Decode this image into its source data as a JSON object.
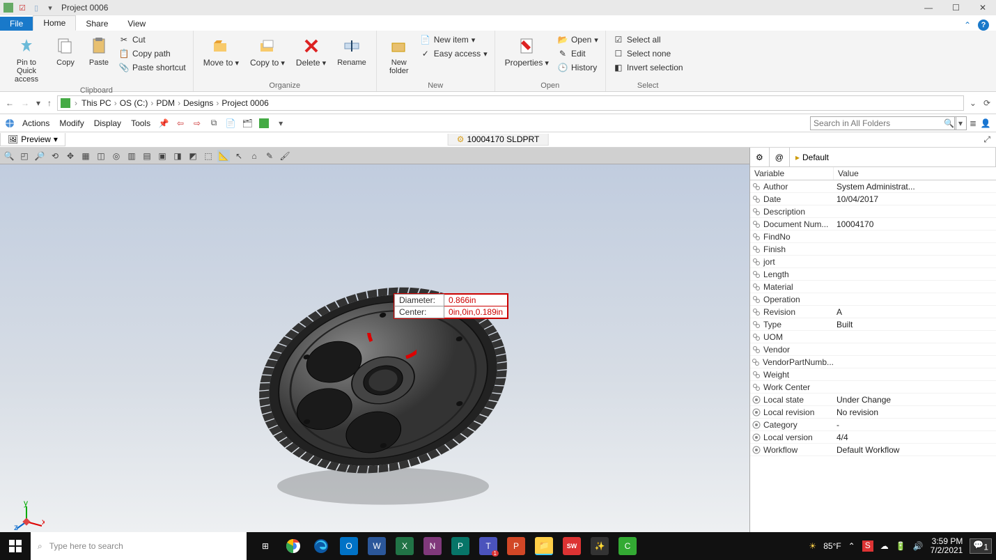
{
  "titlebar": {
    "title": "Project 0006"
  },
  "ribbon": {
    "tabs": {
      "file": "File",
      "home": "Home",
      "share": "Share",
      "view": "View"
    },
    "groups": {
      "clipboard": {
        "label": "Clipboard",
        "pin": "Pin to Quick access",
        "copy": "Copy",
        "paste": "Paste",
        "cut": "Cut",
        "copypath": "Copy path",
        "shortcut": "Paste shortcut"
      },
      "organize": {
        "label": "Organize",
        "moveto": "Move to",
        "copyto": "Copy to",
        "delete": "Delete",
        "rename": "Rename"
      },
      "new": {
        "label": "New",
        "folder": "New folder",
        "newitem": "New item",
        "easy": "Easy access"
      },
      "open": {
        "label": "Open",
        "properties": "Properties",
        "open": "Open",
        "edit": "Edit",
        "history": "History"
      },
      "select": {
        "label": "Select",
        "all": "Select all",
        "none": "Select none",
        "invert": "Invert selection"
      }
    }
  },
  "breadcrumb": [
    "This PC",
    "OS (C:)",
    "PDM",
    "Designs",
    "Project 0006"
  ],
  "pdm_toolbar": {
    "actions": "Actions",
    "modify": "Modify",
    "display": "Display",
    "tools": "Tools",
    "search_placeholder": "Search in All Folders"
  },
  "preview_tab": "Preview",
  "file_tag": "10004170 SLDPRT",
  "measure": {
    "diam_label": "Diameter:",
    "diam_val": "0.866in",
    "center_label": "Center:",
    "center_val": "0in,0in,0.189in"
  },
  "props_tabs": {
    "default": "Default"
  },
  "props_header": {
    "var": "Variable",
    "val": "Value"
  },
  "properties": [
    {
      "k": "Author",
      "v": "System Administrat...",
      "t": "link"
    },
    {
      "k": "Date",
      "v": "10/04/2017",
      "t": "link"
    },
    {
      "k": "Description",
      "v": "",
      "t": "link"
    },
    {
      "k": "Document Num...",
      "v": "10004170",
      "t": "link"
    },
    {
      "k": "FindNo",
      "v": "",
      "t": "link"
    },
    {
      "k": "Finish",
      "v": "",
      "t": "link"
    },
    {
      "k": "jort",
      "v": "",
      "t": "link"
    },
    {
      "k": "Length",
      "v": "",
      "t": "link"
    },
    {
      "k": "Material",
      "v": "",
      "t": "link"
    },
    {
      "k": "Operation",
      "v": "",
      "t": "link"
    },
    {
      "k": "Revision",
      "v": "A",
      "t": "link"
    },
    {
      "k": "Type",
      "v": "Built",
      "t": "link"
    },
    {
      "k": "UOM",
      "v": "",
      "t": "link"
    },
    {
      "k": "Vendor",
      "v": "",
      "t": "link"
    },
    {
      "k": "VendorPartNumb...",
      "v": "",
      "t": "link"
    },
    {
      "k": "Weight",
      "v": "",
      "t": "link"
    },
    {
      "k": "Work Center",
      "v": "",
      "t": "link"
    },
    {
      "k": "Local state",
      "v": "Under Change",
      "t": "gear"
    },
    {
      "k": "Local revision",
      "v": "No revision",
      "t": "gear"
    },
    {
      "k": "Category",
      "v": "-",
      "t": "gear"
    },
    {
      "k": "Local version",
      "v": "4/4",
      "t": "gear"
    },
    {
      "k": "Workflow",
      "v": "Default Workflow",
      "t": "gear"
    }
  ],
  "taskbar": {
    "search_placeholder": "Type here to search",
    "weather": "85°F",
    "time": "3:59 PM",
    "date": "7/2/2021",
    "notif_count": "1"
  }
}
